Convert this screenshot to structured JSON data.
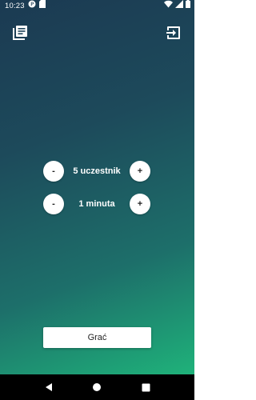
{
  "status_bar": {
    "time": "10:23",
    "left_icons": [
      "parking-notification-icon",
      "sd-card-icon"
    ],
    "right_icons": [
      "wifi-icon",
      "signal-icon",
      "battery-icon"
    ]
  },
  "toolbar": {
    "left_icon": "library-books-icon",
    "right_icon": "exit-to-app-icon"
  },
  "players": {
    "minus_label": "-",
    "value_label": "5 uczestnik",
    "plus_label": "+"
  },
  "time": {
    "minus_label": "-",
    "value_label": "1 minuta",
    "plus_label": "+"
  },
  "play_button_label": "Grać",
  "nav_bar": {
    "icons": [
      "back-icon",
      "home-icon",
      "recents-icon"
    ]
  },
  "colors": {
    "gradient_top": "#1b3a52",
    "gradient_bottom": "#1fb27a",
    "button_bg": "#ffffff",
    "text_light": "#ffffff",
    "text_dark": "#222222"
  }
}
